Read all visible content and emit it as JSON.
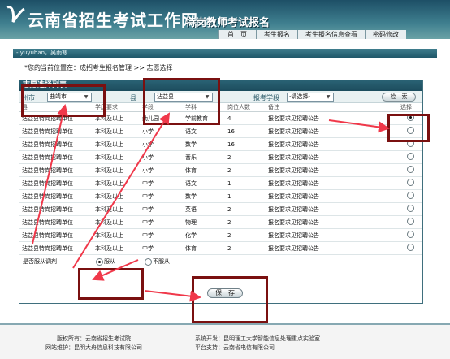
{
  "header": {
    "title": "云南省招生考试工作网",
    "subtitle": "特岗教师考试报名",
    "nav": [
      "首　页",
      "考生报名",
      "考生报名信息查看",
      "密码修改"
    ]
  },
  "userbar": {
    "text": "- yuyuhan，吴雨寒"
  },
  "breadcrumb": "*您的当前位置在：成招考生报名管理 >> 志愿选择",
  "panel": {
    "title": "志愿选择列表",
    "filters": {
      "prefecture_label": "州市",
      "prefecture_value": "曲靖市",
      "county_label": "县",
      "county_value": "沾益县",
      "level_label": "报考学段",
      "level_value": "-请选择-",
      "find_button": "检　索"
    },
    "columns": [
      "县",
      "学历要求",
      "学段",
      "学科",
      "岗位人数",
      "备注",
      "选择"
    ],
    "rows": [
      {
        "unit": "沾益县特岗招聘单位",
        "edu": "本科及以上",
        "stage": "幼儿园",
        "subject": "学前教育",
        "count": "4",
        "note": "报名要求见招聘公告",
        "checked": true
      },
      {
        "unit": "沾益县特岗招聘单位",
        "edu": "本科及以上",
        "stage": "小学",
        "subject": "语文",
        "count": "16",
        "note": "报名要求见招聘公告",
        "checked": false
      },
      {
        "unit": "沾益县特岗招聘单位",
        "edu": "本科及以上",
        "stage": "小学",
        "subject": "数学",
        "count": "16",
        "note": "报名要求见招聘公告",
        "checked": false
      },
      {
        "unit": "沾益县特岗招聘单位",
        "edu": "本科及以上",
        "stage": "小学",
        "subject": "音乐",
        "count": "2",
        "note": "报名要求见招聘公告",
        "checked": false
      },
      {
        "unit": "沾益县特岗招聘单位",
        "edu": "本科及以上",
        "stage": "小学",
        "subject": "体育",
        "count": "2",
        "note": "报名要求见招聘公告",
        "checked": false
      },
      {
        "unit": "沾益县特岗招聘单位",
        "edu": "本科及以上",
        "stage": "中学",
        "subject": "语文",
        "count": "1",
        "note": "报名要求见招聘公告",
        "checked": false
      },
      {
        "unit": "沾益县特岗招聘单位",
        "edu": "本科及以上",
        "stage": "中学",
        "subject": "数学",
        "count": "1",
        "note": "报名要求见招聘公告",
        "checked": false
      },
      {
        "unit": "沾益县特岗招聘单位",
        "edu": "本科及以上",
        "stage": "中学",
        "subject": "英语",
        "count": "2",
        "note": "报名要求见招聘公告",
        "checked": false
      },
      {
        "unit": "沾益县特岗招聘单位",
        "edu": "本科及以上",
        "stage": "中学",
        "subject": "物理",
        "count": "2",
        "note": "报名要求见招聘公告",
        "checked": false
      },
      {
        "unit": "沾益县特岗招聘单位",
        "edu": "本科及以上",
        "stage": "中学",
        "subject": "化学",
        "count": "2",
        "note": "报名要求见招聘公告",
        "checked": false
      },
      {
        "unit": "沾益县特岗招聘单位",
        "edu": "本科及以上",
        "stage": "中学",
        "subject": "体育",
        "count": "2",
        "note": "报名要求见招聘公告",
        "checked": false
      }
    ],
    "accept": {
      "label": "是否服从调剂",
      "yes": "服从",
      "no": "不服从",
      "selected": "yes"
    },
    "save_button": "保　存"
  },
  "footer": {
    "copyright": "版权所有：云南省招生考试院",
    "maintenance": "网站维护：昆明大舟信息科技有限公司",
    "developer": "系统开发：昆明理工大学智能信息处理重点实验室",
    "platform": "平台支持：云南省电信有限公司"
  },
  "colors": {
    "header": "#2f6a7b",
    "annotation": "#7a1010",
    "arrow": "#f0384a"
  }
}
